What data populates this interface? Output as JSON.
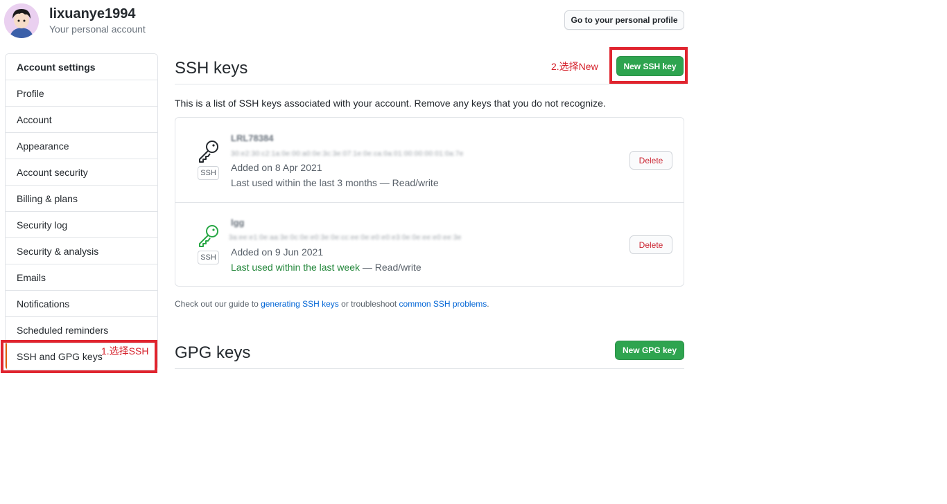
{
  "header": {
    "username": "lixuanye1994",
    "subtitle": "Your personal account",
    "profile_button": "Go to your personal profile"
  },
  "sidebar": {
    "heading": "Account settings",
    "items": [
      {
        "label": "Profile"
      },
      {
        "label": "Account"
      },
      {
        "label": "Appearance"
      },
      {
        "label": "Account security"
      },
      {
        "label": "Billing & plans"
      },
      {
        "label": "Security log"
      },
      {
        "label": "Security & analysis"
      },
      {
        "label": "Emails"
      },
      {
        "label": "Notifications"
      },
      {
        "label": "Scheduled reminders"
      },
      {
        "label": "SSH and GPG keys",
        "selected": true
      }
    ]
  },
  "annotations": {
    "select_ssh": "1.选择SSH",
    "select_new": "2.选择New",
    "color": "#e0242e"
  },
  "ssh": {
    "title": "SSH keys",
    "new_button": "New SSH key",
    "description": "This is a list of SSH keys associated with your account. Remove any keys that you do not recognize.",
    "keys": [
      {
        "title": "LRL78384",
        "fingerprint": "30:e2:30:c2:1a:0e:00:a0:0e:3c:3e:07:1e:0e:ca:0a:01:00:00:00:01:0a:7e",
        "type_label": "SSH",
        "added": "Added on 8 Apr 2021",
        "last_used": "Last used within the last 3 months",
        "last_used_recent": false,
        "access": "— Read/write",
        "icon_color": "#24292e",
        "delete_label": "Delete"
      },
      {
        "title": "lgg",
        "fingerprint": "3a:ee:e1:0e:aa:3e:0c:0e:e0:3e:0e:cc:ee:0e:e0:e0:e3:0e:0e:ee:e0:ee:3e",
        "type_label": "SSH",
        "added": "Added on 9 Jun 2021",
        "last_used": "Last used within the last week",
        "last_used_recent": true,
        "access": "— Read/write",
        "icon_color": "#28a745",
        "delete_label": "Delete"
      }
    ],
    "guide": {
      "prefix": "Check out our guide to ",
      "link1": "generating SSH keys",
      "middle": " or troubleshoot ",
      "link2": "common SSH problems",
      "suffix": "."
    }
  },
  "gpg": {
    "title": "GPG keys",
    "new_button": "New GPG key"
  },
  "colors": {
    "primary_button": "#2ea44f",
    "danger": "#cb2431",
    "link": "#0366d6",
    "recent_used": "#22863a"
  }
}
